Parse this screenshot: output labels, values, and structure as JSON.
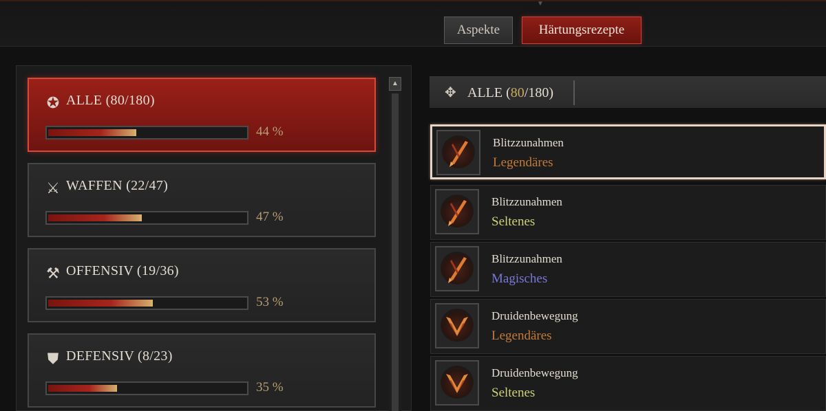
{
  "tabs": {
    "aspekte": "Aspekte",
    "haertung": "Härtungsrezepte"
  },
  "categories": [
    {
      "label": "ALLE (80/180)",
      "pct": "44 %",
      "progress": 0.44,
      "icon": "star-icon",
      "active": true
    },
    {
      "label": "WAFFEN (22/47)",
      "pct": "47 %",
      "progress": 0.47,
      "icon": "swords-icon",
      "active": false
    },
    {
      "label": "OFFENSIV (19/36)",
      "pct": "53 %",
      "progress": 0.53,
      "icon": "axe-icon",
      "active": false
    },
    {
      "label": "DEFENSIV (8/23)",
      "pct": "35 %",
      "progress": 0.35,
      "icon": "shield-icon",
      "active": false
    }
  ],
  "right_header": {
    "prefix": "ALLE (",
    "count": "80",
    "suffix": "/180)"
  },
  "items": [
    {
      "name": "Blitzzunahmen",
      "rarity": "Legendäres",
      "color": "#c47a3a",
      "icon": "lightning-sword-icon",
      "selected": true
    },
    {
      "name": "Blitzzunahmen",
      "rarity": "Seltenes",
      "color": "#cdd27a",
      "icon": "lightning-sword-icon",
      "selected": false
    },
    {
      "name": "Blitzzunahmen",
      "rarity": "Magisches",
      "color": "#7a78d8",
      "icon": "lightning-sword-icon",
      "selected": false
    },
    {
      "name": "Druidenbewegung",
      "rarity": "Legendäres",
      "color": "#c47a3a",
      "icon": "wings-icon",
      "selected": false
    },
    {
      "name": "Druidenbewegung",
      "rarity": "Seltenes",
      "color": "#cdd27a",
      "icon": "wings-icon",
      "selected": false
    }
  ]
}
